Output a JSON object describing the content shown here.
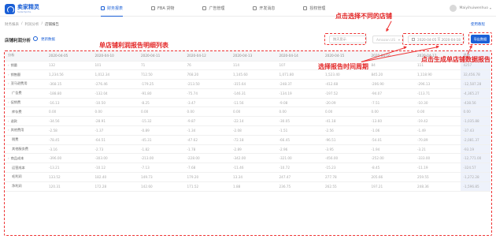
{
  "app": {
    "logo_name": "卖家精灵",
    "logo_sub": "SellerSprite"
  },
  "nav": [
    {
      "label": "财务报表",
      "active": true
    },
    {
      "label": "FBA 货物",
      "active": false
    },
    {
      "label": "广告管理",
      "active": false
    },
    {
      "label": "开发消息",
      "active": false
    },
    {
      "label": "授权管理",
      "active": false
    }
  ],
  "user": {
    "name": "Maiyihuiwenhuo"
  },
  "breadcrumb": [
    "财务报表",
    "利润分析",
    "店铺报告"
  ],
  "help_link": "使用教程",
  "panel": {
    "title": "店铺利润分析",
    "link": "更新数据",
    "currency_select": "按天显示",
    "store_select": "Amazon.US",
    "date_start": "2020-04-05",
    "date_sep": "至",
    "date_end": "2020-04-18",
    "export_button": "导出数据"
  },
  "table": {
    "header_label": "分析",
    "dates": [
      "2020-04-05",
      "2020-04-10",
      "2020-04-11",
      "2020-04-12",
      "2020-04-13",
      "2020-04-14",
      "2020-04-15",
      "2020-04-16",
      "2020-04-17"
    ],
    "total_header": "总计",
    "rows": [
      {
        "label": "销量",
        "expand": true,
        "values": [
          "132",
          "101",
          "71",
          "76",
          "114",
          "107",
          "152",
          "84",
          "111"
        ],
        "total": "4257"
      },
      {
        "label": "销售额",
        "expand": true,
        "values": [
          "1,234.56",
          "1,012.34",
          "712.50",
          "768.20",
          "1,145.60",
          "1,071.80",
          "1,523.40",
          "845.20",
          "1,118.90"
        ],
        "total": "32,456.78"
      },
      {
        "label": "亚马逊费用",
        "expand": true,
        "values": [
          "-368.15",
          "-276.46",
          "-179.25",
          "-213.50",
          "-315.64",
          "-248.37",
          "-412.68",
          "-206.90",
          "-296.13"
        ],
        "total": "-12,587.28"
      },
      {
        "label": "广告费",
        "expand": false,
        "values": [
          "-188.80",
          "-132.04",
          "-91.80",
          "-75.74",
          "-146.31",
          "-134.19",
          "-197.52",
          "-94.07",
          "-113.71"
        ],
        "total": "-4,365.27"
      },
      {
        "label": "促销费",
        "expand": true,
        "values": [
          "-16.13",
          "-10.50",
          "-8.25",
          "-3.47",
          "-11.56",
          "-9.08",
          "-20.09",
          "-7.51",
          "-10.30"
        ],
        "total": "-438.56"
      },
      {
        "label": "库存费",
        "expand": false,
        "values": "0.00",
        "total": "0.00"
      },
      {
        "label": "退款",
        "expand": true,
        "values": [
          "-34.56",
          "-28.91",
          "-15.32",
          "-9.87",
          "-22.14",
          "-30.05",
          "-41.18",
          "-13.60",
          "-19.42"
        ],
        "total": "-1,035.88"
      },
      {
        "label": "其他费用",
        "expand": true,
        "values": [
          "-2.58",
          "-1.37",
          "-0.89",
          "-1.34",
          "-2.08",
          "-1.51",
          "-2.56",
          "-1.06",
          "-1.49"
        ],
        "total": "-37.43"
      },
      {
        "label": "税费",
        "expand": false,
        "values": [
          "-78.45",
          "-64.51",
          "-45.31",
          "-47.62",
          "-72.18",
          "-66.45",
          "-96.51",
          "-54.01",
          "-70.89"
        ],
        "total": "-2,081.37"
      },
      {
        "label": "其他服务费",
        "expand": false,
        "values": [
          "-3.16",
          "-2.73",
          "-1.82",
          "-1.78",
          "-2.89",
          "-2.96",
          "-3.95",
          "-1.94",
          "-3.21"
        ],
        "total": "-93.19"
      },
      {
        "label": "商品成本",
        "expand": true,
        "values": [
          "-396.00",
          "-303.00",
          "-213.00",
          "-228.00",
          "-342.00",
          "-321.00",
          "-456.00",
          "-252.00",
          "-333.00"
        ],
        "total": "-12,771.00"
      },
      {
        "label": "运营成本",
        "expand": false,
        "values": [
          "-13.21",
          "-10.12",
          "-7.13",
          "-7.68",
          "-11.46",
          "-10.72",
          "-15.23",
          "-8.45",
          "-11.19"
        ],
        "total": "-324.57"
      },
      {
        "label": "毛利润",
        "expand": false,
        "values": [
          "133.52",
          "182.40",
          "149.73",
          "179.20",
          "13.34",
          "247.47",
          "277.78",
          "205.66",
          "259.55"
        ],
        "total": "-1,272.28"
      },
      {
        "label": "净利润",
        "expand": false,
        "values": [
          "120.31",
          "172.28",
          "142.60",
          "171.52",
          "1.88",
          "236.75",
          "262.55",
          "197.21",
          "248.36"
        ],
        "total": "-1,596.85"
      }
    ]
  },
  "annotations": {
    "list_label": "单店铺利润报告明细列表",
    "store_label": "点击选择不同的店铺",
    "date_label": "选择报告时间周期",
    "export_label": "点击生成单店铺数据报告",
    "color": "#e32525"
  },
  "colors": {
    "accent": "#1a5fd6",
    "annotation": "#e33333"
  }
}
